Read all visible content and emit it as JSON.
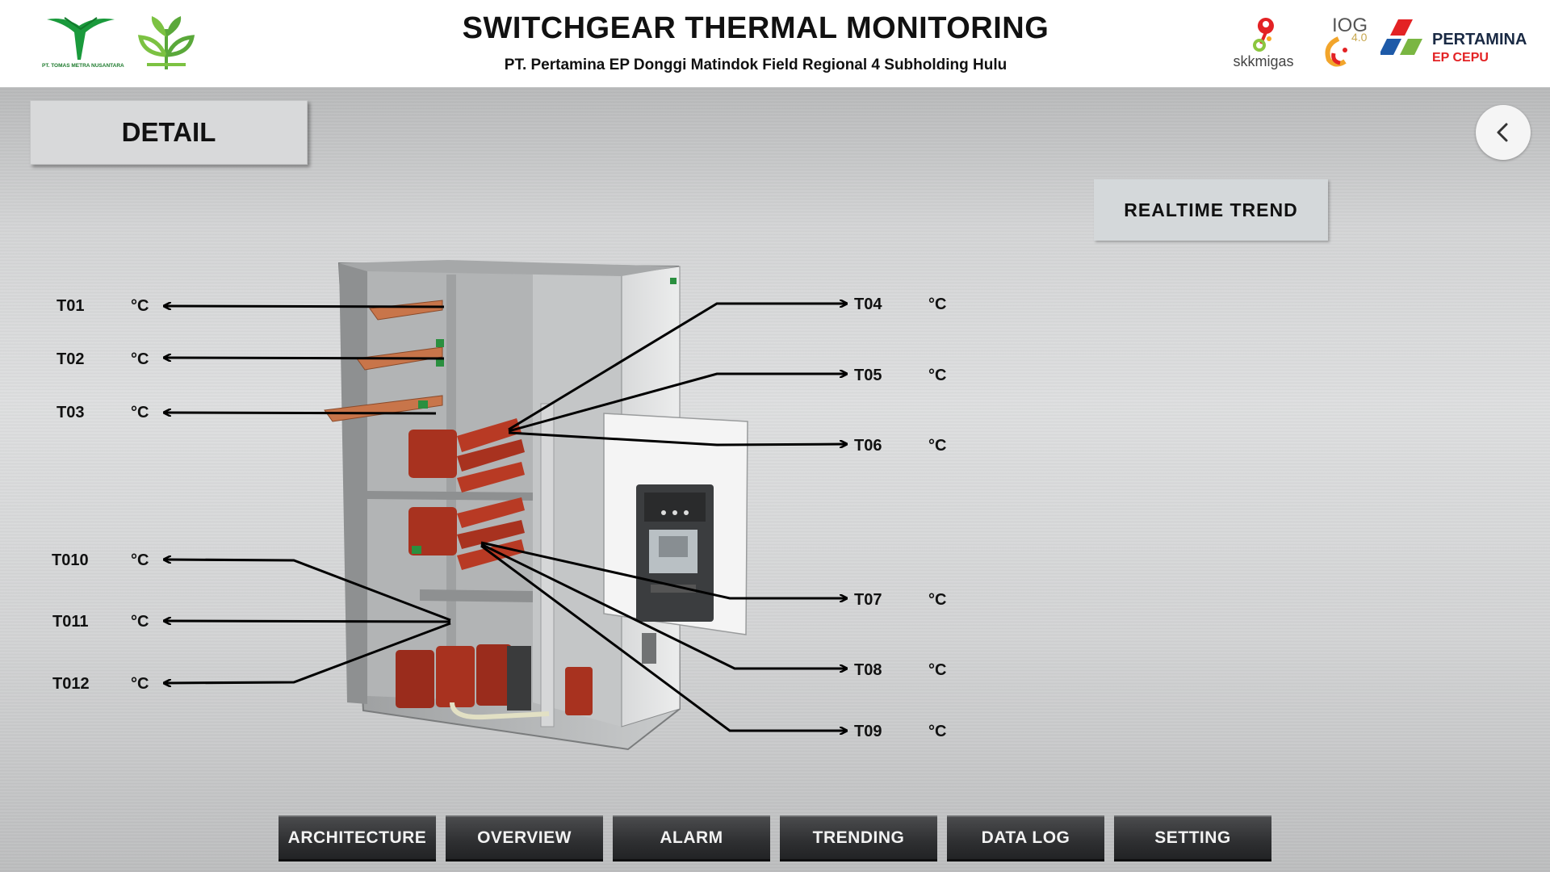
{
  "header": {
    "title": "SWITCHGEAR THERMAL MONITORING",
    "subtitle": "PT. Pertamina EP Donggi Matindok Field Regional 4 Subholding Hulu",
    "logos": {
      "tomas": "PT. TOMAS METRA NUSANTARA",
      "skk": "skkmigas",
      "iog": "IOG",
      "iog_sub": "4.0",
      "pertamina": "PERTAMINA",
      "pertamina_sub": "EP CEPU"
    }
  },
  "page": {
    "section_title": "DETAIL",
    "realtime_trend_label": "REALTIME  TREND",
    "back_icon": "chevron-left-icon"
  },
  "sensors": {
    "left": [
      {
        "id": "T01",
        "unit": "°C"
      },
      {
        "id": "T02",
        "unit": "°C"
      },
      {
        "id": "T03",
        "unit": "°C"
      },
      {
        "id": "T010",
        "unit": "°C"
      },
      {
        "id": "T011",
        "unit": "°C"
      },
      {
        "id": "T012",
        "unit": "°C"
      }
    ],
    "right": [
      {
        "id": "T04",
        "unit": "°C"
      },
      {
        "id": "T05",
        "unit": "°C"
      },
      {
        "id": "T06",
        "unit": "°C"
      },
      {
        "id": "T07",
        "unit": "°C"
      },
      {
        "id": "T08",
        "unit": "°C"
      },
      {
        "id": "T09",
        "unit": "°C"
      }
    ]
  },
  "nav": [
    {
      "label": "ARCHITECTURE"
    },
    {
      "label": "OVERVIEW"
    },
    {
      "label": "ALARM"
    },
    {
      "label": "TRENDING"
    },
    {
      "label": "DATA LOG"
    },
    {
      "label": "SETTING"
    }
  ],
  "colors": {
    "header_bg": "#ffffff",
    "panel_bg": "#d6d7d8",
    "nav_bg": "#2e2f31",
    "busbar": "#c8754a",
    "insulator": "#a8321f",
    "pertamina_red": "#e32224",
    "pertamina_blue": "#1e5aa8",
    "pertamina_green": "#7ab642"
  }
}
